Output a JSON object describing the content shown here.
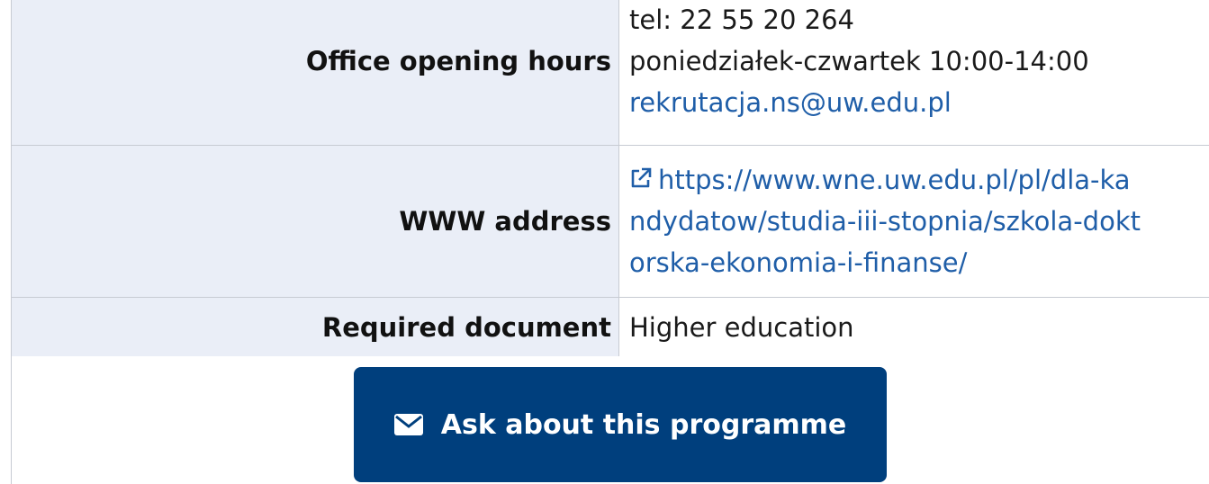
{
  "table": {
    "rows": [
      {
        "label": "Office opening hours",
        "lines": [
          "tel: 22 55 20 264",
          "poniedziałek-czwartek 10:00-14:00"
        ],
        "email": "rekrutacja.ns@uw.edu.pl"
      },
      {
        "label": "WWW address",
        "link_lines": [
          "https://www.wne.uw.edu.pl/pl/dla-ka",
          "ndydatow/studia-iii-stopnia/szkola-dokt",
          "orska-ekonomia-i-finanse/"
        ]
      },
      {
        "label": "Required document",
        "value": "Higher education"
      }
    ]
  },
  "cta": {
    "label": "Ask about this programme",
    "icon": "envelope-icon"
  },
  "colors": {
    "link": "#1f5ea8",
    "header_bg": "#eaeef7",
    "button_bg": "#003f7d"
  }
}
